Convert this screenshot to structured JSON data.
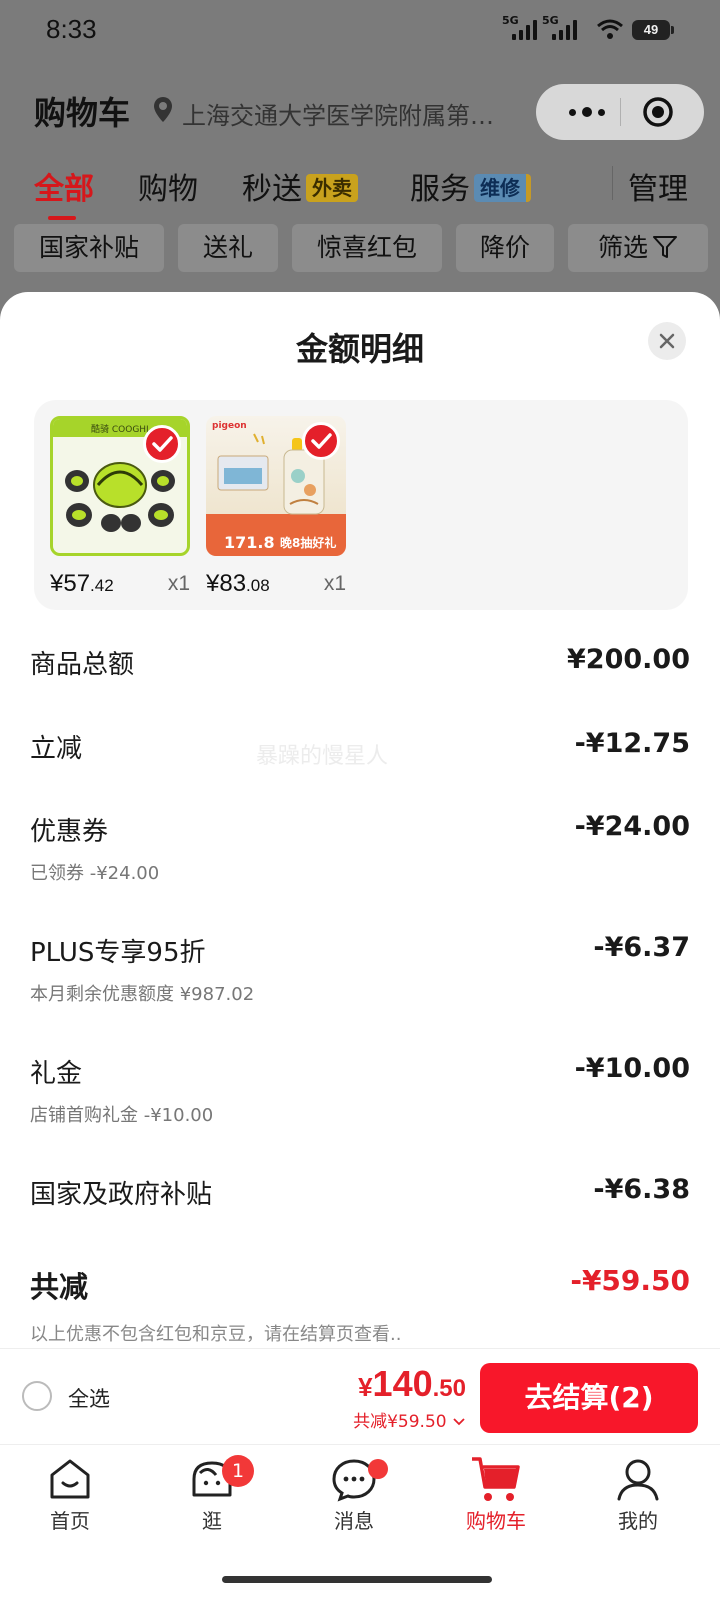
{
  "status_bar": {
    "time": "8:33",
    "net1": "5G",
    "net2": "5G",
    "battery": "49"
  },
  "header": {
    "title": "购物车",
    "address": "上海交通大学医学院附属第九..."
  },
  "tabs": [
    {
      "label": "全部"
    },
    {
      "label": "购物"
    },
    {
      "label": "秒送",
      "tag": "外卖"
    },
    {
      "label": "服务",
      "tag": "维修"
    },
    {
      "label": "管理"
    }
  ],
  "chips": [
    "国家补贴",
    "送礼",
    "惊喜红包",
    "降价",
    "筛选"
  ],
  "sheet": {
    "title": "金额明细",
    "watermark": "暴躁的慢星人",
    "goods": [
      {
        "brand": "酷骑 COOGHI",
        "price_int": "¥57",
        "price_dec": ".42",
        "qty": "x1"
      },
      {
        "brand": "pigeon",
        "promo_price": "171.8",
        "promo_text": "晚8抽好礼",
        "price_int": "¥83",
        "price_dec": ".08",
        "qty": "x1"
      }
    ],
    "lines": [
      {
        "label": "商品总额",
        "value": "¥200.00",
        "sub": ""
      },
      {
        "label": "立减",
        "value": "-¥12.75",
        "sub": ""
      },
      {
        "label": "优惠券",
        "value": "-¥24.00",
        "sub": "已领券 -¥24.00"
      },
      {
        "label": "PLUS专享95折",
        "value": "-¥6.37",
        "sub": "本月剩余优惠额度 ¥987.02"
      },
      {
        "label": "礼金",
        "value": "-¥10.00",
        "sub": "店铺首购礼金 -¥10.00"
      },
      {
        "label": "国家及政府补贴",
        "value": "-¥6.38",
        "sub": ""
      }
    ],
    "total": {
      "label": "共减",
      "value": "-¥59.50"
    },
    "note": "以上优惠不包含红包和京豆，请在结算页查看.."
  },
  "checkout": {
    "select_all": "全选",
    "currency": "¥",
    "amount_int": "140",
    "amount_dec": ".50",
    "saved": "共减¥59.50",
    "button": "去结算(2)"
  },
  "nav": [
    {
      "label": "首页",
      "icon": "home-icon"
    },
    {
      "label": "逛",
      "icon": "explore-icon",
      "badge": "1"
    },
    {
      "label": "消息",
      "icon": "message-icon"
    },
    {
      "label": "购物车",
      "icon": "cart-icon"
    },
    {
      "label": "我的",
      "icon": "profile-icon"
    }
  ],
  "colors": {
    "accent": "#e4202a",
    "button": "#f8172a",
    "overlay": "#7b7b7b"
  }
}
